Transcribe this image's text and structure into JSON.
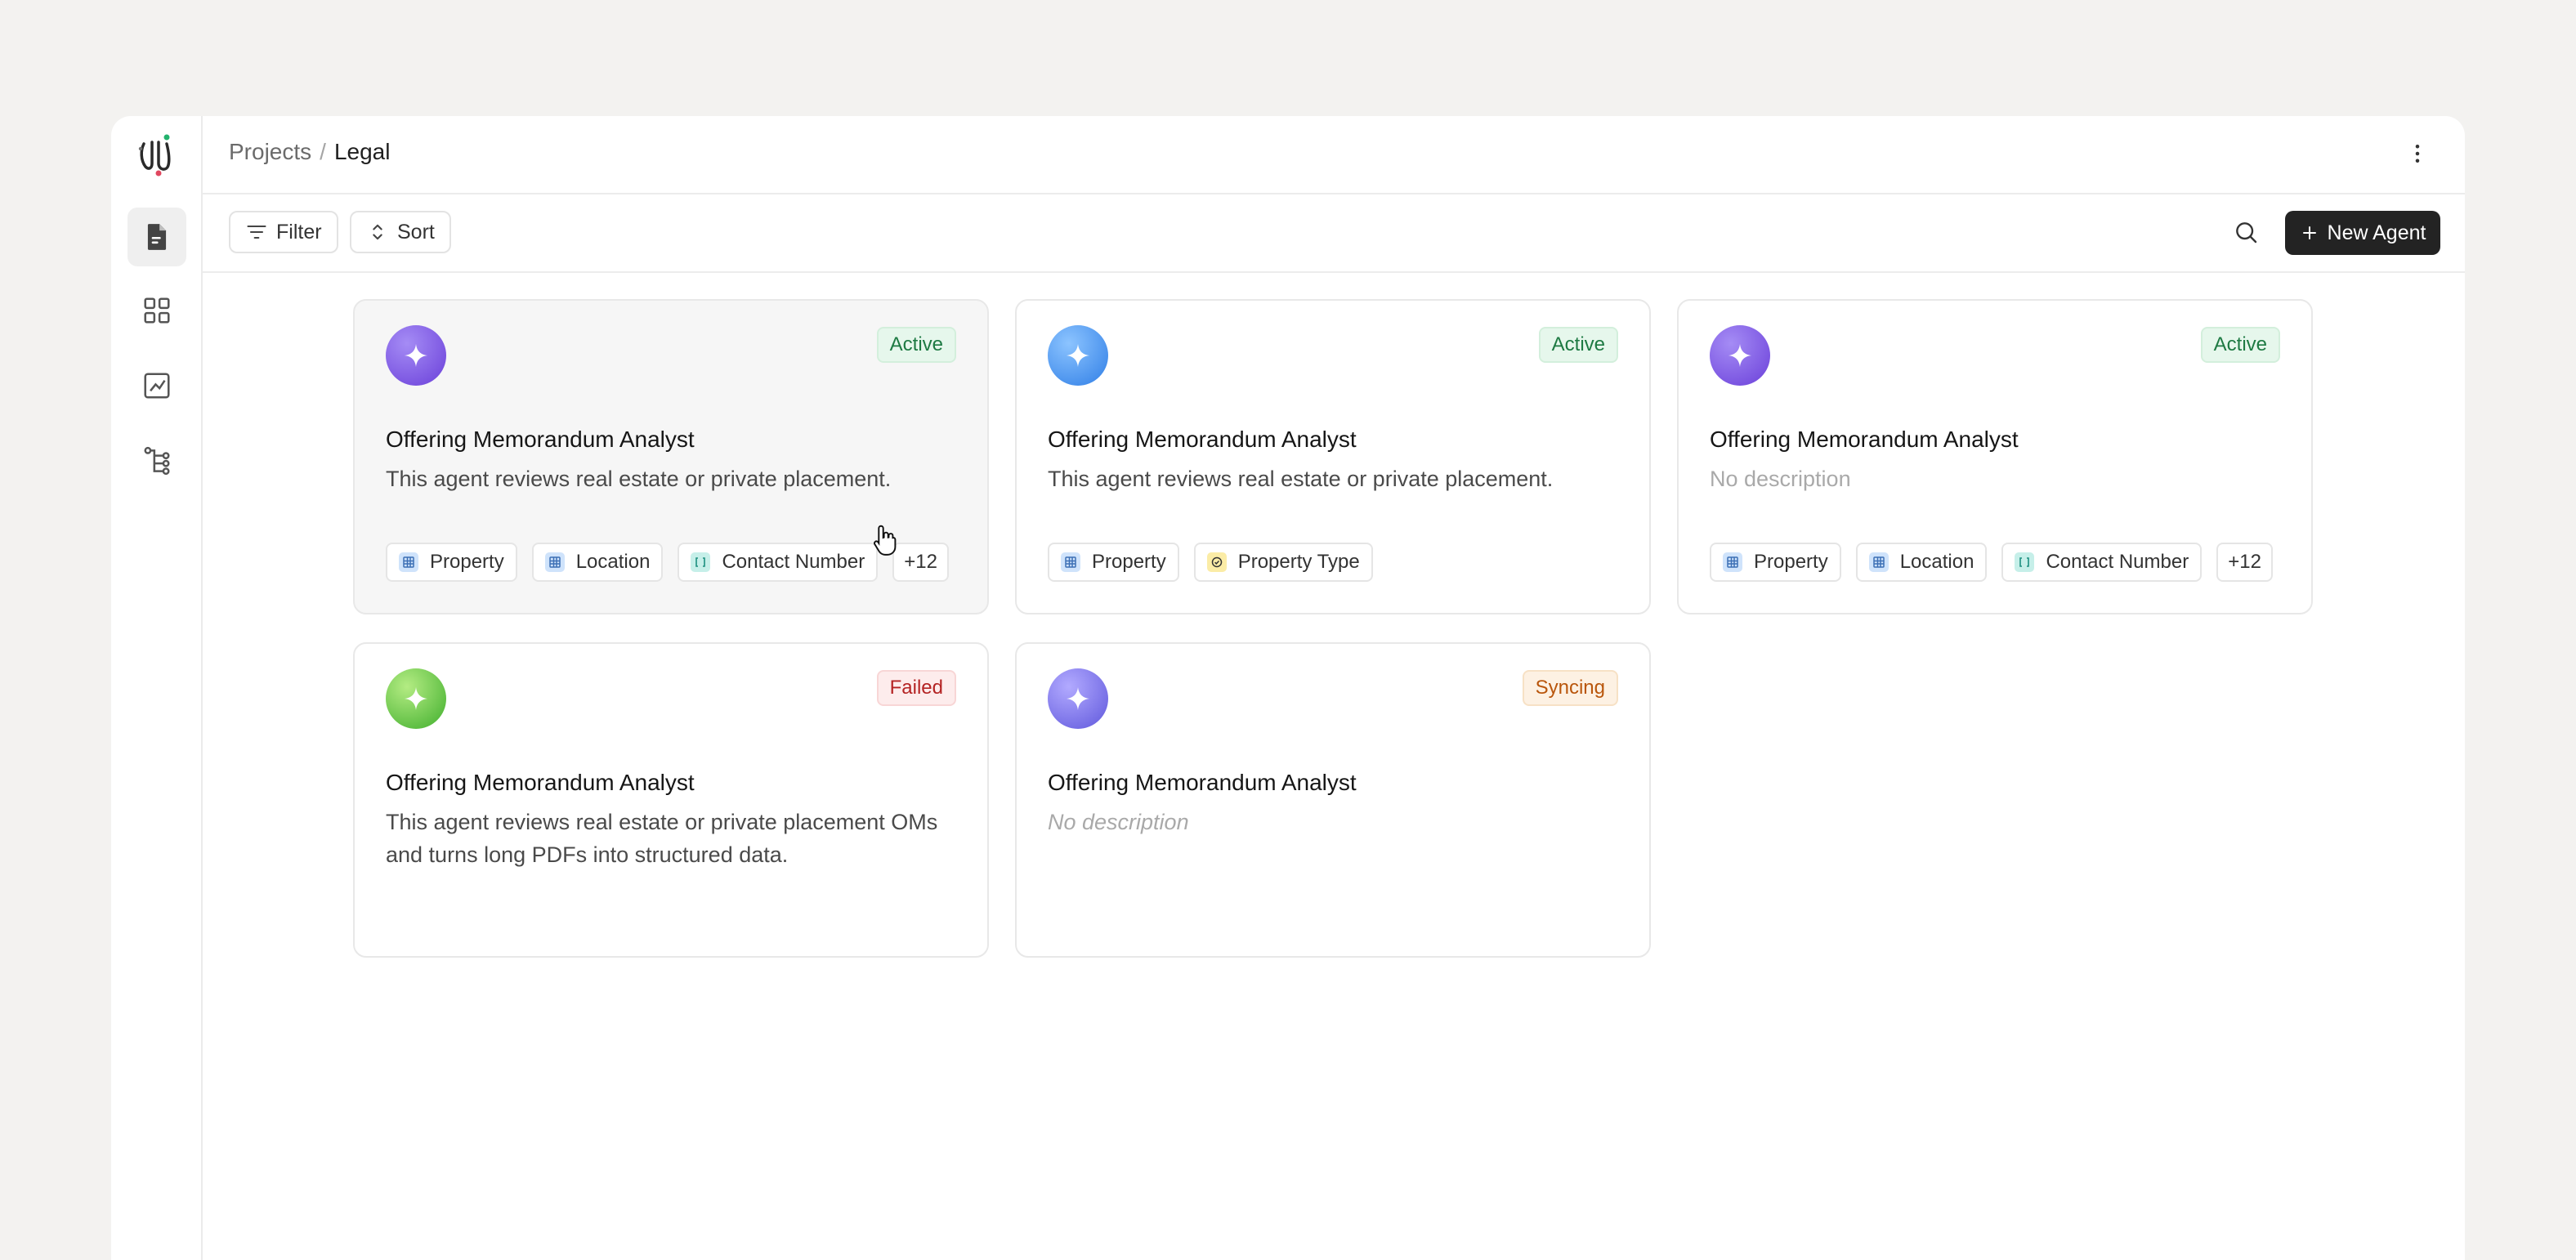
{
  "breadcrumb": {
    "parent": "Projects",
    "separator": "/",
    "current": "Legal"
  },
  "toolbar": {
    "filter_label": "Filter",
    "sort_label": "Sort",
    "new_agent_label": "New Agent"
  },
  "sidebar": {
    "items": [
      "documents-icon",
      "grid-icon",
      "chart-icon",
      "tree-icon"
    ]
  },
  "colors": {
    "accent_dark": "#232323",
    "active_badge": "#1e7a43",
    "failed_badge": "#b42323",
    "syncing_badge": "#b9560c"
  },
  "cards": [
    {
      "title": "Offering Memorandum Analyst",
      "description": "This agent reviews real estate or private placement.",
      "status": "Active",
      "tags": [
        {
          "label": "Property",
          "icon": "table-icon"
        },
        {
          "label": "Location",
          "icon": "table-icon"
        },
        {
          "label": "Contact Number",
          "icon": "brackets-icon"
        }
      ],
      "more": "+12"
    },
    {
      "title": "Offering Memorandum Analyst",
      "description": "This agent reviews real estate or private placement.",
      "status": "Active",
      "tags": [
        {
          "label": "Property",
          "icon": "table-icon"
        },
        {
          "label": "Property Type",
          "icon": "check-circle-icon"
        }
      ]
    },
    {
      "title": "Offering Memorandum Analyst",
      "description": "No description",
      "status": "Active",
      "tags": [
        {
          "label": "Property",
          "icon": "table-icon"
        },
        {
          "label": "Location",
          "icon": "table-icon"
        },
        {
          "label": "Contact Number",
          "icon": "brackets-icon"
        }
      ],
      "more": "+12"
    },
    {
      "title": "Offering Memorandum Analyst",
      "description": "This agent reviews real estate or private placement OMs and turns long PDFs into structured data.",
      "status": "Failed"
    },
    {
      "title": "Offering Memorandum Analyst",
      "description": "No description",
      "status": "Syncing"
    }
  ]
}
